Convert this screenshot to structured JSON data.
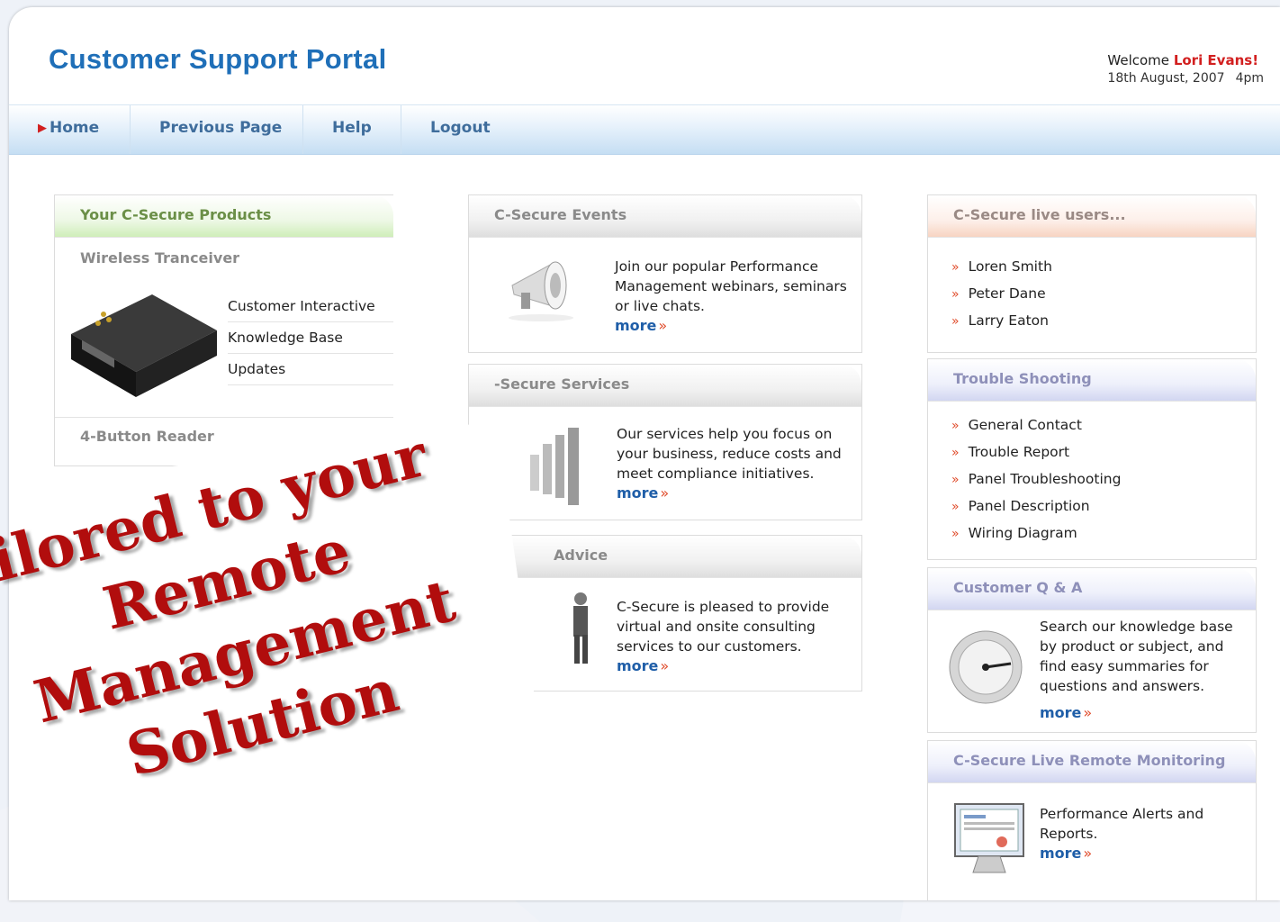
{
  "header": {
    "title": "Customer Support Portal",
    "welcome_prefix": "Welcome",
    "user_name": "Lori Evans!",
    "date": "18th August, 2007",
    "time": "4pm"
  },
  "nav": {
    "home": "Home",
    "previous": "Previous Page",
    "help": "Help",
    "logout": "Logout"
  },
  "products": {
    "heading": "Your C-Secure Products",
    "item1": "Wireless Tranceiver",
    "links": [
      "Customer Interactive",
      "Knowledge Base",
      "Updates"
    ],
    "item2": "4-Button Reader"
  },
  "events": {
    "heading": "C-Secure Events",
    "text": "Join our popular Performance Management webinars, seminars or live chats.",
    "more": "more"
  },
  "services": {
    "heading": "-Secure Services",
    "text": "Our services help you focus on your business, reduce costs and meet compliance initiatives.",
    "more": "more"
  },
  "advice": {
    "heading": "Advice",
    "text": "C-Secure is pleased to provide virtual and onsite consulting services to our customers.",
    "more": "more"
  },
  "live_users": {
    "heading": "C-Secure live users...",
    "users": [
      "Loren Smith",
      "Peter Dane",
      "Larry Eaton"
    ]
  },
  "trouble": {
    "heading": "Trouble Shooting",
    "items": [
      "General Contact",
      "Trouble Report",
      "Panel Troubleshooting",
      "Panel Description",
      "Wiring Diagram"
    ]
  },
  "qa": {
    "heading": "Customer Q & A",
    "text": "Search our knowledge base by product or subject, and find easy summaries for questions and answers.",
    "more": "more"
  },
  "monitoring": {
    "heading": "C-Secure Live Remote Monitoring",
    "text": "Performance Alerts and Reports.",
    "more": "more"
  },
  "overlay": {
    "line1": "ilored to your",
    "line2": "Remote",
    "line3": "Management",
    "line4": "Solution"
  },
  "icons": {
    "bullet": "double-chevron-right-icon",
    "nav_arrow": "triangle-right-icon"
  },
  "colors": {
    "title_blue": "#1f6fb8",
    "accent_red": "#d21f1f",
    "link_blue": "#1f5ea8",
    "overlay_red": "#b10d0d"
  }
}
